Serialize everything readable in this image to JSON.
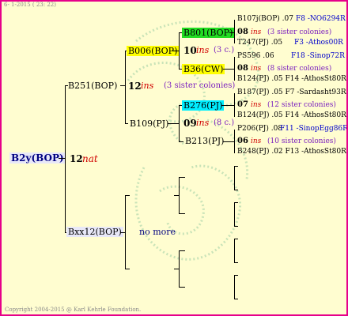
{
  "header": {
    "date": "6- 1-2015 ( 23: 22)"
  },
  "footer": {
    "copyright": "Copyright 2004-2015 @ Karl Kehrle Foundation."
  },
  "colors": {
    "border": "#e6008a",
    "background": "#fffdd0",
    "green_box": "#22dd22",
    "yellow_box": "#ffff00",
    "cyan_box": "#00eeff",
    "root_box": "#e8e8f8"
  },
  "root": {
    "name": "B2y(BOP)",
    "year": "12",
    "mark": "nat"
  },
  "gen1": {
    "upper": {
      "name": "B251(BOP)",
      "year": "12",
      "mark": "ins",
      "note": "(3 sister colonies)"
    },
    "lower": {
      "name": "Bxx12(BOP)",
      "note": "no more"
    }
  },
  "gen2": {
    "a": {
      "name": "B006(BOP)",
      "year": "10",
      "mark": "ins",
      "note": "(3 c.)"
    },
    "b": {
      "name": "B109(PJ)",
      "year": "09",
      "mark": "ins",
      "note": "(8 c.)"
    }
  },
  "gen3": {
    "a": {
      "name": "B801(BOP)"
    },
    "b": {
      "name": "B36(CW)"
    },
    "c": {
      "name": "B276(PJ)"
    },
    "d": {
      "name": "B213(PJ)"
    }
  },
  "gen4": [
    {
      "top": "B107j(BOP) .07",
      "top_right": "F8 -NO6294R",
      "year": "08",
      "mark": "ins",
      "note": "(3 sister colonies)",
      "bottom": "T247(PJ) .05",
      "bottom_right": "F3 -Athos00R"
    },
    {
      "top": "PS596 .06",
      "top_right": "F18 -Sinop72R",
      "year": "08",
      "mark": "ins",
      "note": "(8 sister colonies)",
      "bottom": "B124(PJ) .05 F14 -AthosSt80R",
      "bottom_right": ""
    },
    {
      "top": "B187(PJ) .05 F7 -Sardasht93R",
      "top_right": "",
      "year": "07",
      "mark": "ins",
      "note": "(12 sister colonies)",
      "bottom": "B124(PJ) .05 F14 -AthosSt80R",
      "bottom_right": ""
    },
    {
      "top": "P206(PJ) .08",
      "top_right": "F11 -SinopEgg86R",
      "year": "06",
      "mark": "ins",
      "note": "(10 sister colonies)",
      "bottom": "B248(PJ) .02 F13 -AthosSt80R",
      "bottom_right": ""
    }
  ]
}
